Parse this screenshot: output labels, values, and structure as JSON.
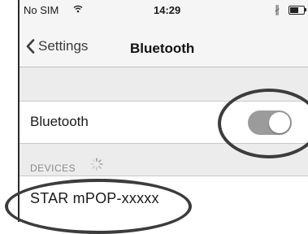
{
  "status_bar": {
    "carrier": "No SIM",
    "wifi_icon": "wifi-icon",
    "time": "14:29",
    "bluetooth_icon": "bluetooth-icon",
    "bluetooth_glyph": "∦",
    "battery_icon": "battery-icon",
    "battery_level": 0.6
  },
  "nav": {
    "back_icon": "chevron-left-icon",
    "back_label": "Settings",
    "title": "Bluetooth"
  },
  "bluetooth_row": {
    "label": "Bluetooth",
    "toggle_on": true
  },
  "devices_section": {
    "header": "DEVICES",
    "spinner_icon": "loading-spinner-icon"
  },
  "devices": [
    {
      "name": "STAR mPOP-xxxxx"
    }
  ],
  "colors": {
    "background": "#ececec",
    "toggle_track": "#9b9b9b",
    "annotation": "#3c3c3c"
  }
}
